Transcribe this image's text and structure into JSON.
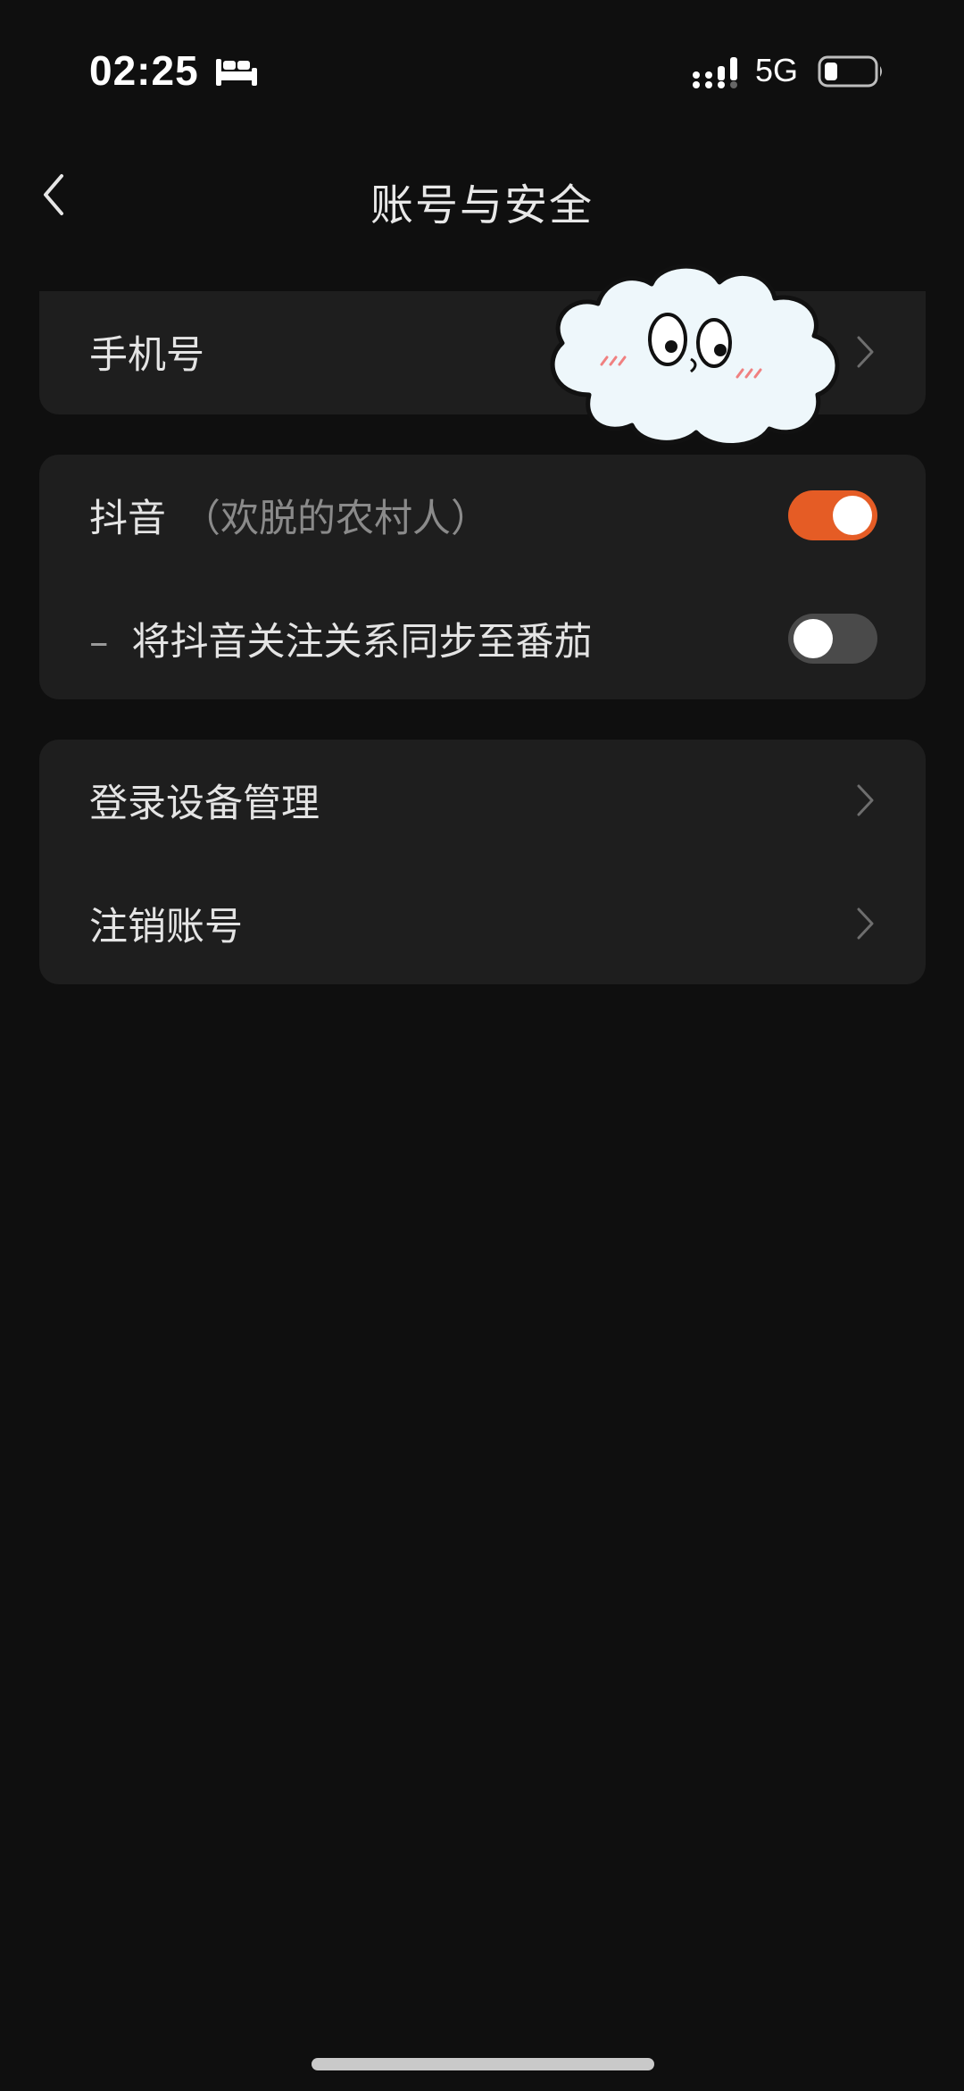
{
  "status_bar": {
    "time": "02:25",
    "network": "5G",
    "icons": [
      "sleep-icon",
      "signal-icon",
      "battery-icon"
    ]
  },
  "header": {
    "title": "账号与安全",
    "back_icon": "chevron-left-icon"
  },
  "sections": {
    "phone": {
      "label": "手机号"
    },
    "douyin": {
      "label": "抖音",
      "nickname": "（欢脱的农村人）",
      "enabled": true,
      "sync_label": "将抖音关注关系同步至番茄",
      "sync_dash": "–",
      "sync_enabled": false
    },
    "device": {
      "label": "登录设备管理"
    },
    "cancel": {
      "label": "注销账号"
    }
  },
  "colors": {
    "background": "#0f0f0f",
    "card": "#1e1e1e",
    "toggle_on": "#e55c25",
    "toggle_off": "#4a4a4a"
  }
}
